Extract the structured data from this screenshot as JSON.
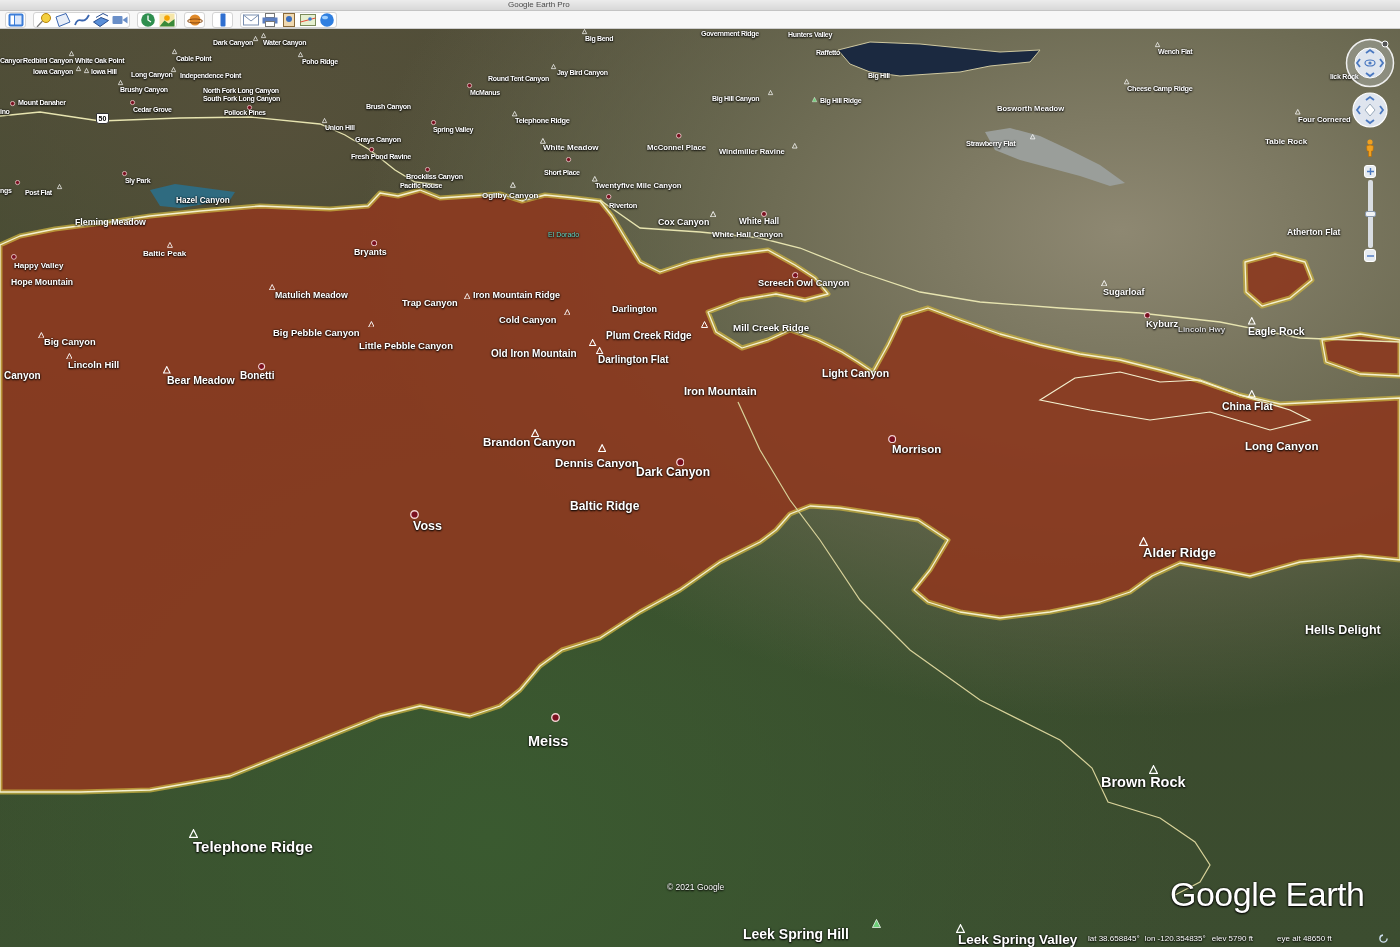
{
  "window": {
    "title": "Google Earth Pro"
  },
  "toolbar": [
    [
      {
        "kind": "sidebar"
      }
    ],
    [
      {
        "kind": "placemark"
      },
      {
        "kind": "polygon"
      },
      {
        "kind": "path"
      },
      {
        "kind": "overlay"
      },
      {
        "kind": "tour"
      }
    ],
    [
      {
        "kind": "history"
      },
      {
        "kind": "sun"
      }
    ],
    [
      {
        "kind": "planets"
      }
    ],
    [
      {
        "kind": "ruler"
      }
    ],
    [
      {
        "kind": "email"
      },
      {
        "kind": "print"
      },
      {
        "kind": "image"
      },
      {
        "kind": "maps"
      },
      {
        "kind": "globe"
      }
    ]
  ],
  "map": {
    "labels": [
      {
        "text": "Dark Canyon",
        "kind": "peak"
      },
      {
        "text": "Water Canyon",
        "kind": "peak"
      },
      {
        "text": "Big Bend",
        "kind": "peak"
      },
      {
        "text": "Government Ridge",
        "kind": "plain"
      },
      {
        "text": "Hunters Valley",
        "kind": "plain"
      },
      {
        "text": "Canyon",
        "kind": "plain"
      },
      {
        "text": "Redbird Canyon",
        "kind": "plain"
      },
      {
        "text": "White Oak Point",
        "kind": "peak"
      },
      {
        "text": "Cable Point",
        "kind": "peak"
      },
      {
        "text": "Poho Ridge",
        "kind": "peak"
      },
      {
        "text": "Raffetto",
        "kind": "plain"
      },
      {
        "text": "Wench Flat",
        "kind": "peak"
      },
      {
        "text": "Iowa Canyon",
        "kind": "peak"
      },
      {
        "text": "Iowa Hill",
        "kind": "peak"
      },
      {
        "text": "Long Canyon",
        "kind": "plain"
      },
      {
        "text": "Independence Point",
        "kind": "peak"
      },
      {
        "text": "Round Tent Canyon",
        "kind": "plain"
      },
      {
        "text": "Jay Bird Canyon",
        "kind": "peak"
      },
      {
        "text": "Big Hill",
        "kind": "plain"
      },
      {
        "text": "lick Rock",
        "kind": "plain"
      },
      {
        "text": "Brushy Canyon",
        "kind": "peak"
      },
      {
        "text": "North Fork Long Canyon",
        "kind": "plain"
      },
      {
        "text": "McManus",
        "kind": "town"
      },
      {
        "text": "Cheese Camp Ridge",
        "kind": "peak"
      },
      {
        "text": "Mount Danaher",
        "kind": "town"
      },
      {
        "text": "South Fork Long Canyon",
        "kind": "plain"
      },
      {
        "text": "Big Hill Canyon",
        "kind": "peak"
      },
      {
        "text": "Big Hill Ridge",
        "kind": "summit"
      },
      {
        "text": "ino",
        "kind": "plain"
      },
      {
        "text": "Cedar Grove",
        "kind": "town"
      },
      {
        "text": "Pollock Pines",
        "kind": "town"
      },
      {
        "text": "Brush Canyon",
        "kind": "plain"
      },
      {
        "text": "Bosworth Meadow",
        "kind": "plain"
      },
      {
        "text": "Telephone Ridge",
        "kind": "peak"
      },
      {
        "text": "Four Cornered",
        "kind": "peak"
      },
      {
        "text": "Union Hill",
        "kind": "peak"
      },
      {
        "text": "Spring Valley",
        "kind": "town"
      },
      {
        "text": "Grays Canyon",
        "kind": "plain"
      },
      {
        "text": "White Meadow",
        "kind": "peak"
      },
      {
        "text": "McConnel Place",
        "kind": "town"
      },
      {
        "text": "Windmiller Ravine",
        "kind": "peak"
      },
      {
        "text": "Strawberry Flat",
        "kind": "peak"
      },
      {
        "text": "Table Rock",
        "kind": "plain"
      },
      {
        "text": "Fresh Pond Ravine",
        "kind": "town"
      },
      {
        "text": "Sly Park",
        "kind": "town"
      },
      {
        "text": "Brockliss Canyon",
        "kind": "plain"
      },
      {
        "text": "Short Place",
        "kind": "town"
      },
      {
        "text": "Pacific House",
        "kind": "town"
      },
      {
        "text": "Twentyfive Mile Canyon",
        "kind": "peak"
      },
      {
        "text": "ngs",
        "kind": "town"
      },
      {
        "text": "Post Flat",
        "kind": "peak"
      },
      {
        "text": "Ogilby Canyon",
        "kind": "peak"
      },
      {
        "text": "Hazel Canyon",
        "kind": "plain"
      },
      {
        "text": "Riverton",
        "kind": "town"
      },
      {
        "text": "Fleming Meadow",
        "kind": "plain"
      },
      {
        "text": "Cox Canyon",
        "kind": "peak"
      },
      {
        "text": "White Hall",
        "kind": "town"
      },
      {
        "text": "White Hall Canyon",
        "kind": "plain"
      },
      {
        "text": "Atherton Flat",
        "kind": "plain"
      },
      {
        "text": "Baltic Peak",
        "kind": "peak"
      },
      {
        "text": "Bryants",
        "kind": "town"
      },
      {
        "text": "Happy Valley",
        "kind": "town"
      },
      {
        "text": "Hope Mountain",
        "kind": "plain"
      },
      {
        "text": "Screech Owl Canyon",
        "kind": "town"
      },
      {
        "text": "Matulich Meadow",
        "kind": "peak"
      },
      {
        "text": "Iron Mountain Ridge",
        "kind": "peak"
      },
      {
        "text": "Sugarloaf",
        "kind": "peak"
      },
      {
        "text": "Trap Canyon",
        "kind": "plain"
      },
      {
        "text": "Darlington",
        "kind": "plain"
      },
      {
        "text": "Cold Canyon",
        "kind": "peak"
      },
      {
        "text": "Kyburz",
        "kind": "town"
      },
      {
        "text": "Big Pebble Canyon",
        "kind": "peak"
      },
      {
        "text": "Plum Creek Ridge",
        "kind": "plain"
      },
      {
        "text": "Mill Creek Ridge",
        "kind": "peak"
      },
      {
        "text": "Eagle Rock",
        "kind": "peak"
      },
      {
        "text": "Big Canyon",
        "kind": "peak"
      },
      {
        "text": "Little Pebble Canyon",
        "kind": "plain"
      },
      {
        "text": "Old Iron Mountain",
        "kind": "peak"
      },
      {
        "text": "Darlington Flat",
        "kind": "peak"
      },
      {
        "text": "Lincoln Hill",
        "kind": "peak"
      },
      {
        "text": "Canyon",
        "kind": "plain"
      },
      {
        "text": "Bear Meadow",
        "kind": "peak"
      },
      {
        "text": "Bonetti",
        "kind": "town"
      },
      {
        "text": "Light Canyon",
        "kind": "plain"
      },
      {
        "text": "Iron Mountain",
        "kind": "plain"
      },
      {
        "text": "China Flat",
        "kind": "peak"
      },
      {
        "text": "Brandon Canyon",
        "kind": "peak"
      },
      {
        "text": "Morrison",
        "kind": "town"
      },
      {
        "text": "Long Canyon",
        "kind": "plain"
      },
      {
        "text": "Dennis Canyon",
        "kind": "peak"
      },
      {
        "text": "Dark Canyon",
        "kind": "town"
      },
      {
        "text": "Baltic Ridge",
        "kind": "plain"
      },
      {
        "text": "Voss",
        "kind": "town"
      },
      {
        "text": "Alder Ridge",
        "kind": "peak"
      },
      {
        "text": "Hells Delight",
        "kind": "plain"
      },
      {
        "text": "Meiss",
        "kind": "town"
      },
      {
        "text": "Brown Rock",
        "kind": "peak"
      },
      {
        "text": "Telephone Ridge",
        "kind": "peak"
      },
      {
        "text": "Leek Spring Hill",
        "kind": "summit"
      },
      {
        "text": "Leek Spring Valley",
        "kind": "peak"
      }
    ],
    "county_label": "El Dorado",
    "road_label": "Lincoln Hwy",
    "route_shield": "50",
    "copyright": "© 2021 Google",
    "logo": "Google Earth",
    "zoom_slider": {
      "level": 0.5
    }
  },
  "status_bar": [
    "lat 38.658845°",
    "lon -120.354835°",
    "elev 5790 ft",
    "eye alt 48650 ft"
  ]
}
